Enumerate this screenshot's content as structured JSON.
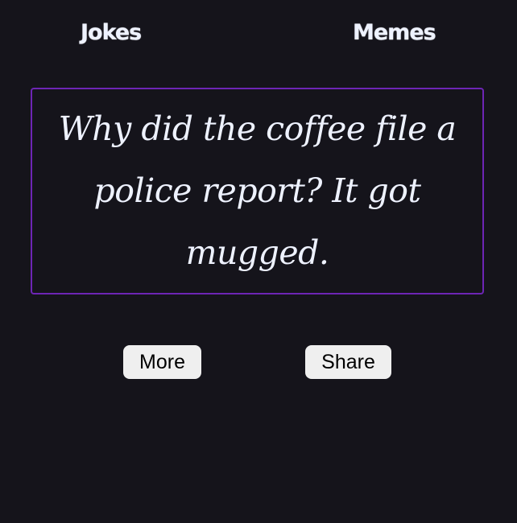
{
  "nav": {
    "jokes_label": "Jokes",
    "memes_label": "Memes"
  },
  "joke": {
    "text": "Why did the coffee file a police report? It got mugged."
  },
  "actions": {
    "more_label": "More",
    "share_label": "Share"
  },
  "colors": {
    "background": "#15141b",
    "card_border": "#6d25b5",
    "text": "#eef2ff",
    "button_bg": "#efefef"
  }
}
